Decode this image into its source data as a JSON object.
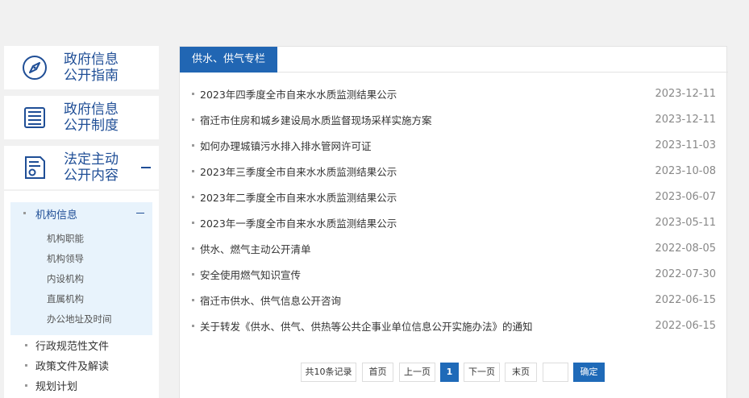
{
  "sidebar": {
    "cards": [
      {
        "line1": "政府信息",
        "line2": "公开指南",
        "icon": "compass-icon"
      },
      {
        "line1": "政府信息",
        "line2": "公开制度",
        "icon": "list-document-icon"
      },
      {
        "line1": "法定主动",
        "line2": "公开内容",
        "icon": "certificate-document-icon"
      }
    ],
    "active_group": "机构信息",
    "active_children": [
      "机构职能",
      "机构领导",
      "内设机构",
      "直属机构",
      "办公地址及时间"
    ],
    "other_items": [
      "行政规范性文件",
      "政策文件及解读",
      "规划计划"
    ]
  },
  "panel": {
    "tab_label": "供水、供气专栏",
    "rows": [
      {
        "title": "2023年四季度全市自来水水质监测结果公示",
        "date": "2023-12-11"
      },
      {
        "title": "宿迁市住房和城乡建设局水质监督现场采样实施方案",
        "date": "2023-12-11"
      },
      {
        "title": "如何办理城镇污水排入排水管网许可证",
        "date": "2023-11-03"
      },
      {
        "title": "2023年三季度全市自来水水质监测结果公示",
        "date": "2023-10-08"
      },
      {
        "title": "2023年二季度全市自来水水质监测结果公示",
        "date": "2023-06-07"
      },
      {
        "title": "2023年一季度全市自来水水质监测结果公示",
        "date": "2023-05-11"
      },
      {
        "title": "供水、燃气主动公开清单",
        "date": "2022-08-05"
      },
      {
        "title": "安全使用燃气知识宣传",
        "date": "2022-07-30"
      },
      {
        "title": "宿迁市供水、供气信息公开咨询",
        "date": "2022-06-15"
      },
      {
        "title": "关于转发《供水、供气、供热等公共企事业单位信息公开实施办法》的通知",
        "date": "2022-06-15"
      }
    ]
  },
  "pager": {
    "total": "共10条记录",
    "first": "首页",
    "prev": "上一页",
    "current": "1",
    "next": "下一页",
    "last": "末页",
    "jump_value": "",
    "confirm": "确定"
  },
  "colors": {
    "accent": "#2166b3",
    "sidebar_title": "#1f4e96",
    "active_bg": "#e8f3fc"
  }
}
